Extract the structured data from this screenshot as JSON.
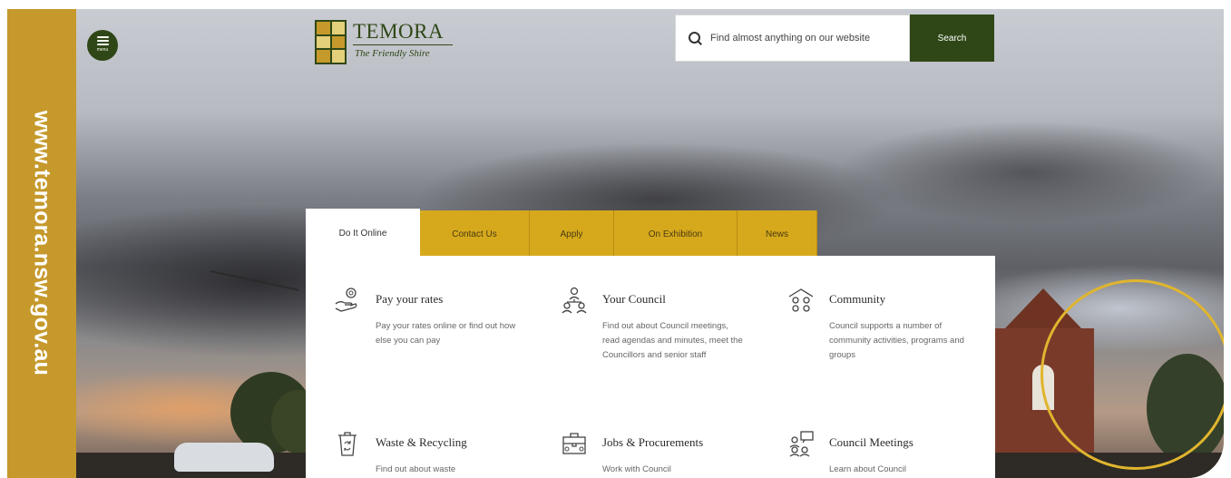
{
  "sidebar_url": "www.temora.nsw.gov.au",
  "header": {
    "menu_label": "menu",
    "logo": {
      "title": "TEMORA",
      "tagline": "The Friendly Shire"
    },
    "search": {
      "placeholder": "Find almost anything on our website",
      "button_label": "Search"
    }
  },
  "tabs": [
    {
      "label": "Do It Online",
      "active": true
    },
    {
      "label": "Contact Us",
      "active": false
    },
    {
      "label": "Apply",
      "active": false
    },
    {
      "label": "On Exhibition",
      "active": false
    },
    {
      "label": "News",
      "active": false
    }
  ],
  "cards": [
    {
      "icon": "hand-coin-icon",
      "title": "Pay your rates",
      "description": "Pay your rates online or find out how else you can pay"
    },
    {
      "icon": "people-hierarchy-icon",
      "title": "Your Council",
      "description": "Find out about Council meetings, read agendas and minutes, meet the Councillors and senior staff"
    },
    {
      "icon": "community-house-icon",
      "title": "Community",
      "description": "Council supports a number of community activities, programs and groups"
    },
    {
      "icon": "recycling-bin-icon",
      "title": "Waste & Recycling",
      "description": "Find out about waste"
    },
    {
      "icon": "briefcase-icon",
      "title": "Jobs & Procurements",
      "description": "Work with Council"
    },
    {
      "icon": "meeting-presentation-icon",
      "title": "Council Meetings",
      "description": "Learn about Council"
    }
  ],
  "colors": {
    "brand_green": "#2f4716",
    "brand_gold": "#c5992b",
    "tab_gold": "#d6a91d"
  }
}
